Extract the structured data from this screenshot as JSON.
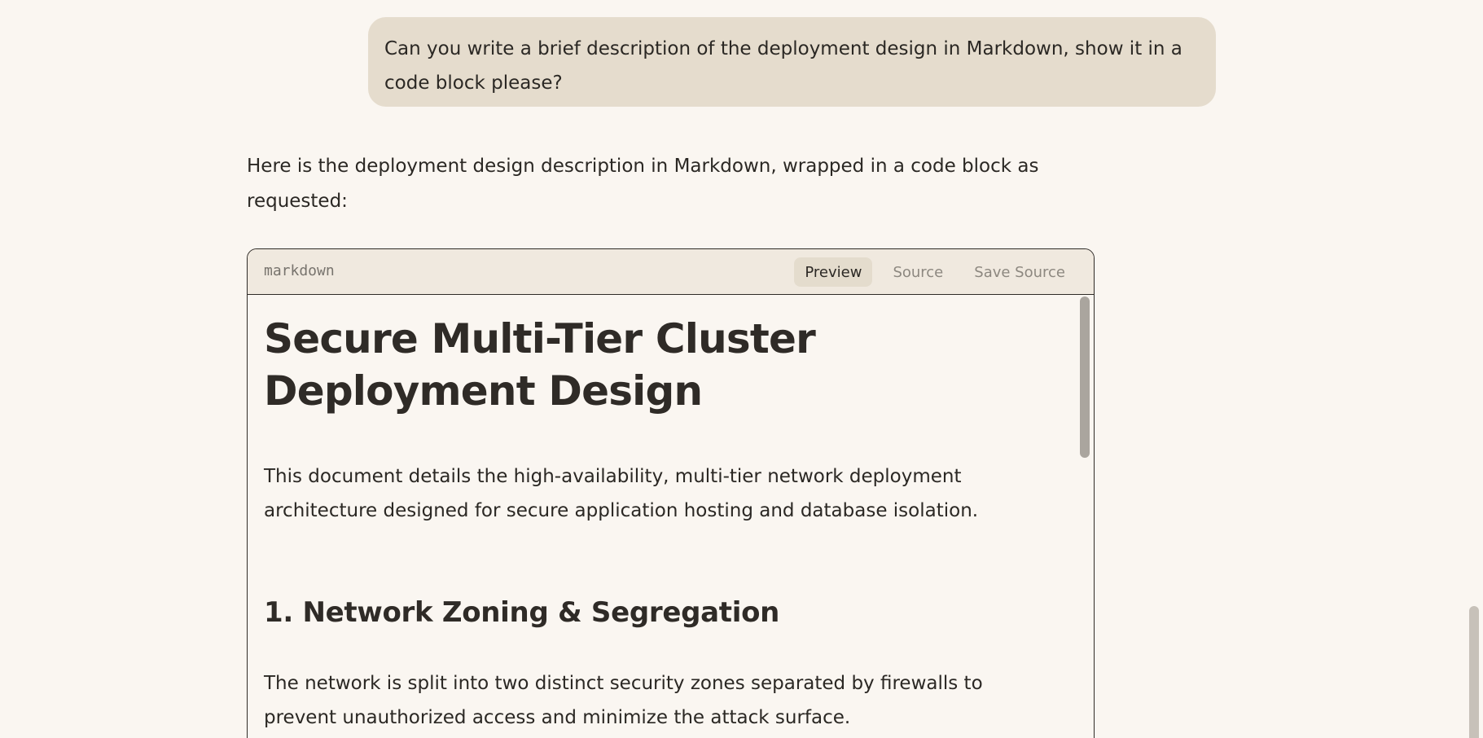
{
  "conversation": {
    "user_message": "Can you write a brief description of the deployment design in Markdown, show it in a code block please?",
    "assistant_intro": "Here is the deployment design description in Markdown, wrapped in a code block as requested:"
  },
  "code_block": {
    "language": "markdown",
    "actions": {
      "preview": "Preview",
      "source": "Source",
      "save_source": "Save Source"
    },
    "active_view": "Preview",
    "preview": {
      "title": "Secure Multi-Tier Cluster Deployment Design",
      "intro": "This document details the high-availability, multi-tier network deployment architecture designed for secure application hosting and database isolation.",
      "section_1": {
        "heading": "1. Network Zoning & Segregation",
        "paragraph": "The network is split into two distinct security zones separated by firewalls to prevent unauthorized access and minimize the attack surface."
      }
    }
  },
  "colors": {
    "background": "#faf6f1",
    "user_bubble": "#e5dccd",
    "code_header": "#f0e9df",
    "active_tab": "#e4dccd",
    "text": "#2b2824"
  }
}
